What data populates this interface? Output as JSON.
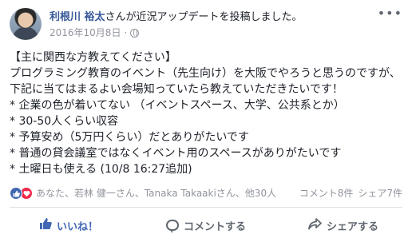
{
  "post": {
    "author": "利根川 裕太",
    "action_text": "さんが近況アップデートを投稿しました。",
    "date": "2016年10月8日",
    "date_separator": "·",
    "menu_glyph": "•••",
    "icons": {
      "privacy": "globe-icon",
      "menu": "more-options-icon"
    },
    "lines": [
      "【主に関西な方教えてください】",
      "プログラミング教育のイベント（先生向け）を大阪でやろうと思うのですが、",
      "下記に当てはまるよい会場知っていたら教えていただきたいです！",
      "* 企業の色が着いてない （イベントスペース、大学、公共系とか）",
      "* 30-50人くらい収容",
      "* 予算安め（5万円くらい）だとありがたいです",
      "* 普通の貸会議室ではなくイベント用のスペースがありがたいです",
      "* 土曜日も使える (10/8 16:27追加)"
    ]
  },
  "stats": {
    "reactors": "あなた、若林 健一さん、Tanaka Takaakiさん、他30人",
    "comments": "コメント8件",
    "shares": "シェア7件",
    "reaction_icons": [
      "like-reaction-icon",
      "love-reaction-icon"
    ]
  },
  "actions": {
    "like": "いいね！",
    "comment": "コメントする",
    "share": "シェアする"
  },
  "colors": {
    "author": "#365899",
    "like_active": "#4267b2",
    "love": "#f0284a",
    "muted": "#90949c",
    "text": "#1d2129"
  }
}
